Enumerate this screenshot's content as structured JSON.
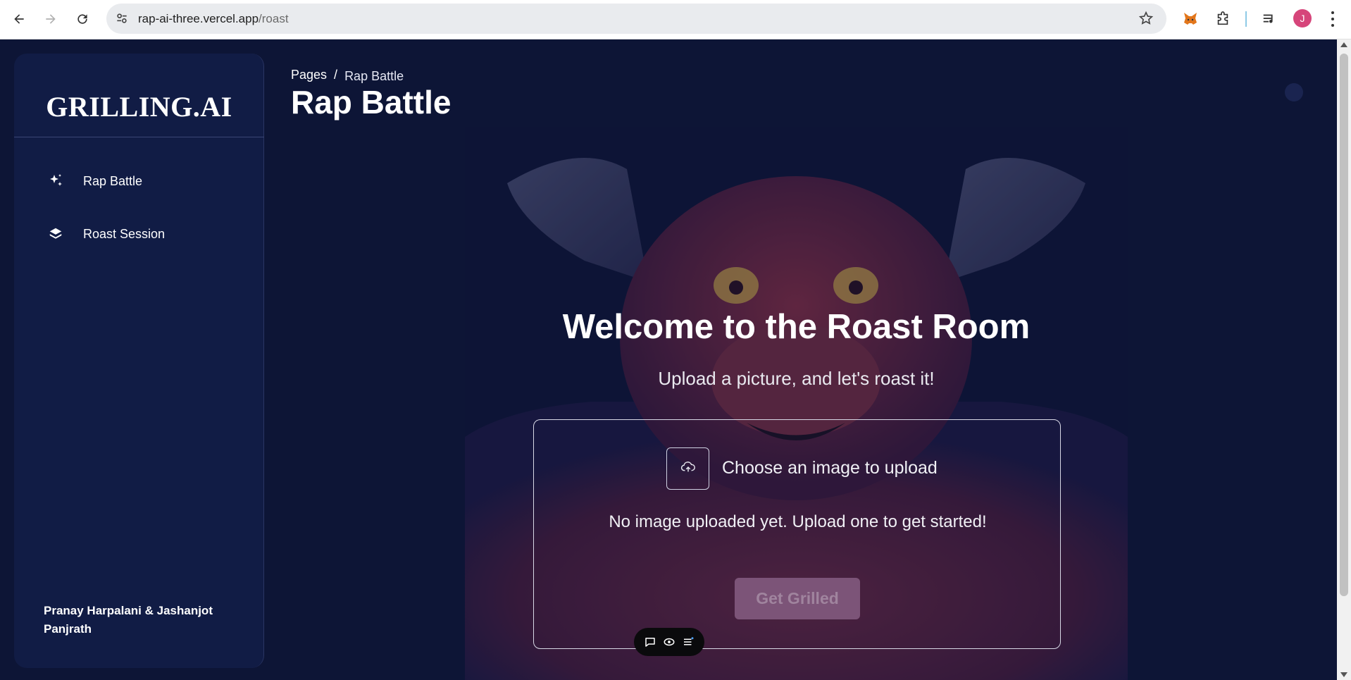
{
  "browser": {
    "url_host": "rap-ai-three.vercel.app",
    "url_path": "/roast",
    "profile_initial": "J",
    "icons": [
      "back-icon",
      "forward-icon",
      "reload-icon",
      "site-settings-icon",
      "bookmark-star-icon",
      "metamask-fox-icon",
      "extensions-puzzle-icon",
      "media-controls-icon",
      "profile-avatar",
      "kebab-menu-icon"
    ]
  },
  "sidebar": {
    "brand": "GRILLING.AI",
    "items": [
      {
        "label": "Rap Battle",
        "icon": "sparkles-icon"
      },
      {
        "label": "Roast Session",
        "icon": "layers-icon"
      }
    ],
    "credits": "Pranay Harpalani & Jashanjot Panjrath"
  },
  "header": {
    "breadcrumb_root": "Pages",
    "breadcrumb_sep": "/",
    "breadcrumb_current": "Rap Battle",
    "title": "Rap Battle"
  },
  "main": {
    "welcome": "Welcome to the Roast Room",
    "subtitle": "Upload a picture, and let's roast it!",
    "upload_label": "Choose an image to upload",
    "empty_message": "No image uploaded yet. Upload one to get started!",
    "submit_label": "Get Grilled"
  },
  "colors": {
    "background": "#0d1536",
    "sidebar": "#111c45",
    "button_disabled": "#7c5478"
  }
}
